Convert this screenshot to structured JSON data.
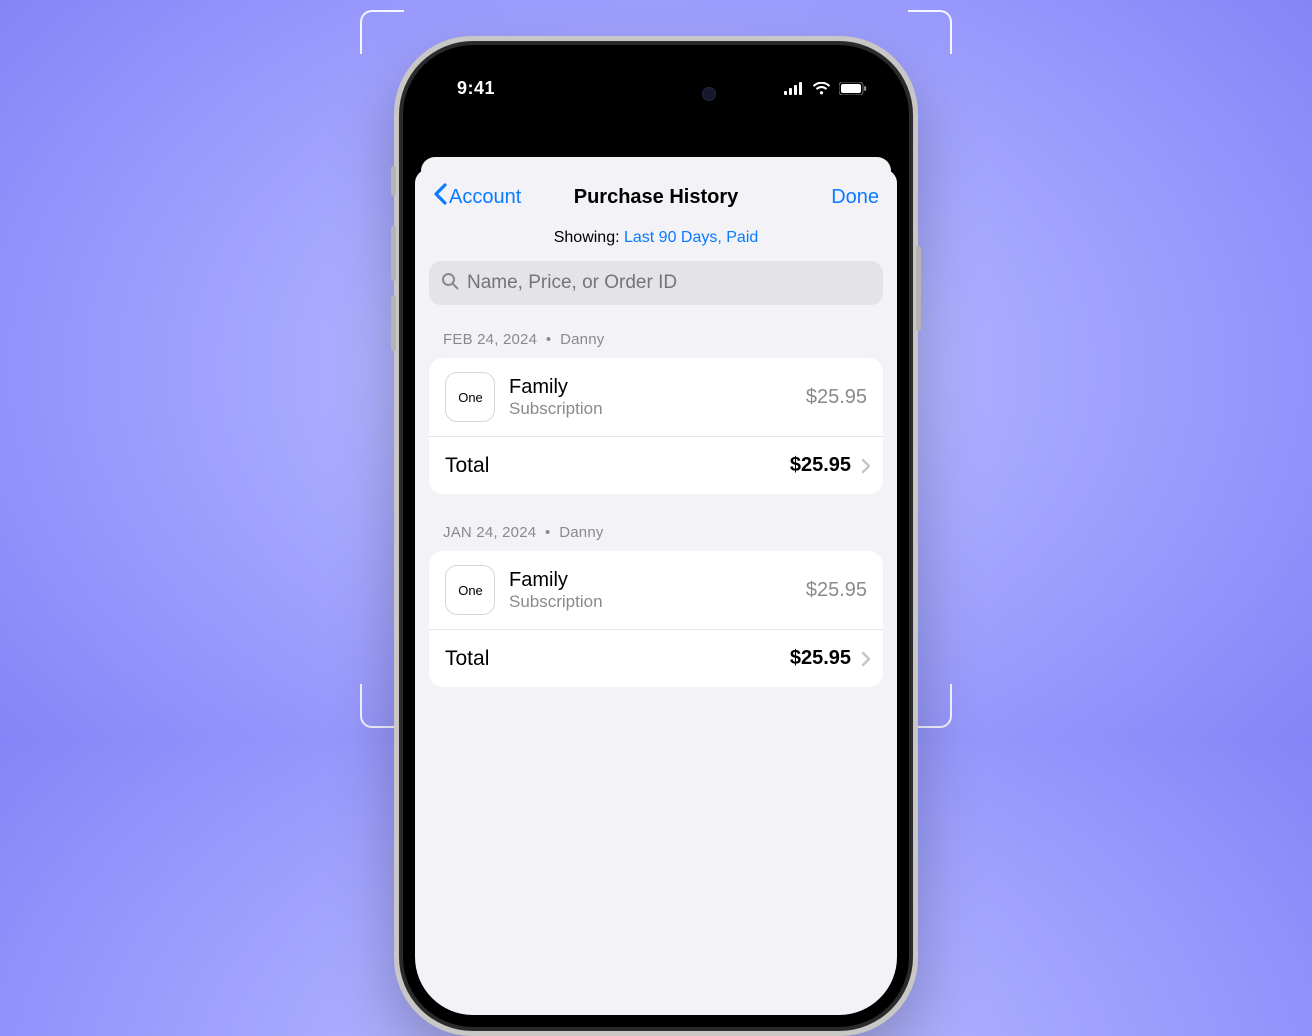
{
  "status": {
    "time": "9:41"
  },
  "nav": {
    "back_label": "Account",
    "title": "Purchase History",
    "done_label": "Done"
  },
  "filter": {
    "prefix": "Showing: ",
    "value": "Last 90 Days, Paid"
  },
  "search": {
    "placeholder": "Name, Price, or Order ID"
  },
  "groups": [
    {
      "date": "FEB 24, 2024",
      "user": "Danny",
      "item": {
        "icon_label": "One",
        "name": "Family",
        "subtitle": "Subscription",
        "price": "$25.95"
      },
      "total_label": "Total",
      "total_price": "$25.95"
    },
    {
      "date": "JAN 24, 2024",
      "user": "Danny",
      "item": {
        "icon_label": "One",
        "name": "Family",
        "subtitle": "Subscription",
        "price": "$25.95"
      },
      "total_label": "Total",
      "total_price": "$25.95"
    }
  ]
}
